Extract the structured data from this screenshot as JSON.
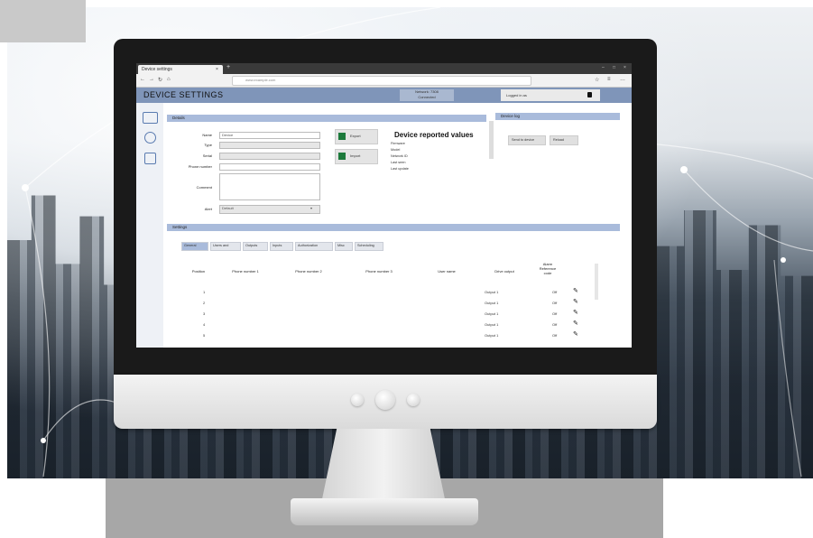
{
  "browser": {
    "tab_title": "Device settings",
    "tab_close": "×",
    "new_tab": "+",
    "url": "www.example.com",
    "nav": {
      "back": "←",
      "forward": "→",
      "reload": "↻",
      "home": "⌂"
    },
    "window_controls": [
      "–",
      "□",
      "×"
    ]
  },
  "app": {
    "title": "DEVICE SETTINGS",
    "network_line1": "Network: 7308",
    "network_line2": "Connected",
    "user_label": "Logged in as"
  },
  "sidebar": {
    "icons": [
      "monitor-icon",
      "user-icon",
      "tablet-icon"
    ]
  },
  "details": {
    "section_title": "Details",
    "fields": [
      {
        "label": "Name",
        "value": "Device"
      },
      {
        "label": "Type",
        "value": ""
      },
      {
        "label": "Serial",
        "value": ""
      },
      {
        "label": "Phone number",
        "value": ""
      },
      {
        "label": "Comment",
        "value": ""
      },
      {
        "label": "Alert",
        "value": "Default"
      }
    ],
    "excel_buttons": [
      "Export",
      "Import"
    ]
  },
  "reported": {
    "title": "Device reported values",
    "rows": [
      {
        "k": "Firmware",
        "v": ""
      },
      {
        "k": "Model",
        "v": ""
      },
      {
        "k": "Network ID",
        "v": ""
      },
      {
        "k": "Last seen",
        "v": ""
      },
      {
        "k": "Last update",
        "v": ""
      }
    ]
  },
  "right_panel": {
    "title": "Device log",
    "buttons": [
      "Send to device",
      "Reload"
    ]
  },
  "settings": {
    "section_title": "Settings",
    "tabs": [
      "General",
      "Users and",
      "Outputs",
      "Inputs",
      "Authorization",
      "Misc",
      "Scheduling"
    ],
    "columns": [
      "Position",
      "Phone number 1",
      "Phone number 2",
      "Phone number 3",
      "User name",
      "Drive output",
      "Alarm Reference code",
      ""
    ],
    "rows": [
      {
        "position": "1",
        "output": "Output 1",
        "off": "Off"
      },
      {
        "position": "2",
        "output": "Output 1",
        "off": "Off"
      },
      {
        "position": "3",
        "output": "Output 1",
        "off": "Off"
      },
      {
        "position": "4",
        "output": "Output 1",
        "off": "Off"
      },
      {
        "position": "5",
        "output": "Output 1",
        "off": "Off"
      }
    ]
  },
  "colors": {
    "header": "#7f95b9",
    "section": "#a9bbdb",
    "excel": "#1d7a3c"
  }
}
